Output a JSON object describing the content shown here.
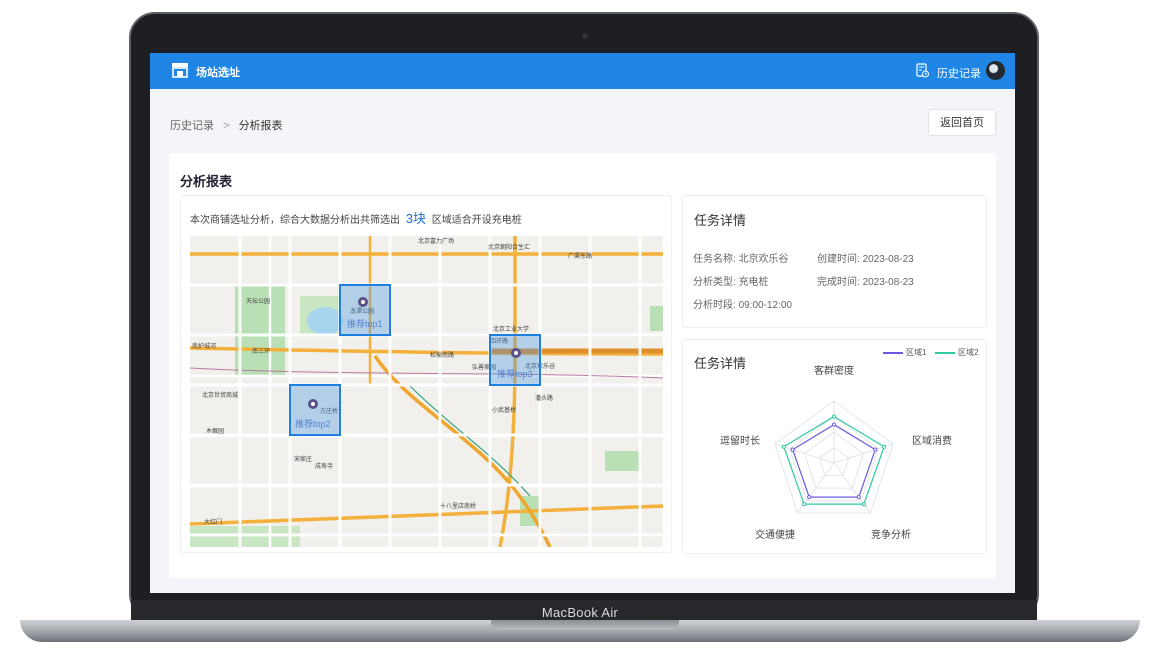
{
  "device": {
    "brand": "MacBook Air"
  },
  "topbar": {
    "app_title": "场站选址",
    "history_label": "历史记录",
    "logo_icon": "store-icon",
    "history_icon": "document-clock-icon"
  },
  "breadcrumb": {
    "parent": "历史记录",
    "separator": ">",
    "current": "分析报表"
  },
  "back_button": {
    "label": "返回首页"
  },
  "report": {
    "title": "分析报表",
    "summary_prefix": "本次商铺选址分析，综合大数据分析出共筛选出",
    "summary_count": "3块",
    "summary_suffix": "区域适合开设充电桩"
  },
  "map": {
    "recommendations": [
      {
        "label": "推荐top1"
      },
      {
        "label": "推荐top2"
      },
      {
        "label": "推荐top3"
      }
    ],
    "place_labels": [
      "北京富力广场",
      "北京朝阳合生汇",
      "广渠东路",
      "天坛公园",
      "龙潭公园",
      "北京工业大学",
      "四环路",
      "北京欢乐谷",
      "南护城河",
      "南三环",
      "松榆南路",
      "弘善家园",
      "北京世贸商城",
      "方庄桥",
      "小武基桥",
      "潘头路",
      "木樨园",
      "宋家庄",
      "十八里店南桥",
      "大红门",
      "成寿寺"
    ]
  },
  "task_detail": {
    "title": "任务详情",
    "name_label": "任务名称:",
    "name_value": "北京欢乐谷",
    "created_label": "创建时间:",
    "created_value": "2023-08-23",
    "type_label": "分析类型:",
    "type_value": "充电桩",
    "done_label": "完成时间:",
    "done_value": "2023-08-23",
    "period_label": "分析时段:",
    "period_value": "09:00-12:00"
  },
  "radar_card": {
    "title": "任务详情",
    "legend": [
      {
        "name": "区域1",
        "color": "#6a5ae0"
      },
      {
        "name": "区域2",
        "color": "#2fc9a2"
      }
    ],
    "axes": [
      "客群密度",
      "区域消费",
      "竞争分析",
      "交通便捷",
      "逗留时长"
    ],
    "series": [
      {
        "name": "区域1",
        "values": [
          0.62,
          0.7,
          0.68,
          0.68,
          0.7
        ]
      },
      {
        "name": "区域2",
        "values": [
          0.75,
          0.85,
          0.82,
          0.82,
          0.85
        ]
      }
    ]
  }
}
